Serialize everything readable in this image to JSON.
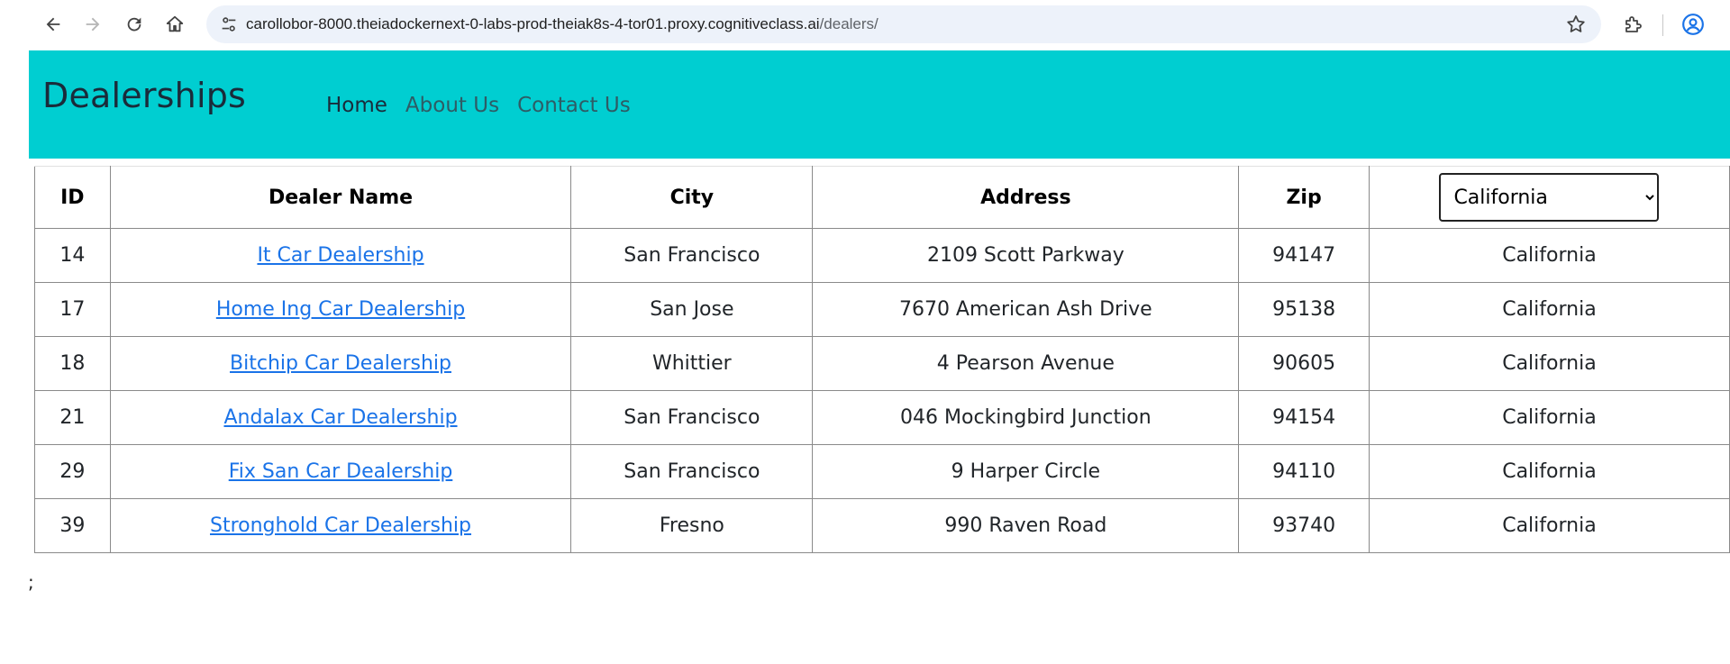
{
  "browser": {
    "url_host": "carollobor-8000.theiadockernext-0-labs-prod-theiak8s-4-tor01.proxy.cognitiveclass.ai",
    "url_path": "/dealers/"
  },
  "header": {
    "brand": "Dealerships",
    "nav": [
      {
        "label": "Home",
        "active": true
      },
      {
        "label": "About Us",
        "active": false
      },
      {
        "label": "Contact Us",
        "active": false
      }
    ],
    "bg_color": "#00ced1"
  },
  "table": {
    "columns": [
      "ID",
      "Dealer Name",
      "City",
      "Address",
      "Zip"
    ],
    "state_filter": {
      "selected": "California"
    },
    "rows": [
      {
        "id": "14",
        "name": "It Car Dealership",
        "city": "San Francisco",
        "address": "2109 Scott Parkway",
        "zip": "94147",
        "state": "California"
      },
      {
        "id": "17",
        "name": "Home Ing Car Dealership",
        "city": "San Jose",
        "address": "7670 American Ash Drive",
        "zip": "95138",
        "state": "California"
      },
      {
        "id": "18",
        "name": "Bitchip Car Dealership",
        "city": "Whittier",
        "address": "4 Pearson Avenue",
        "zip": "90605",
        "state": "California"
      },
      {
        "id": "21",
        "name": "Andalax Car Dealership",
        "city": "San Francisco",
        "address": "046 Mockingbird Junction",
        "zip": "94154",
        "state": "California"
      },
      {
        "id": "29",
        "name": "Fix San Car Dealership",
        "city": "San Francisco",
        "address": "9 Harper Circle",
        "zip": "94110",
        "state": "California"
      },
      {
        "id": "39",
        "name": "Stronghold Car Dealership",
        "city": "Fresno",
        "address": "990 Raven Road",
        "zip": "93740",
        "state": "California"
      }
    ]
  },
  "trailing_text": ";"
}
